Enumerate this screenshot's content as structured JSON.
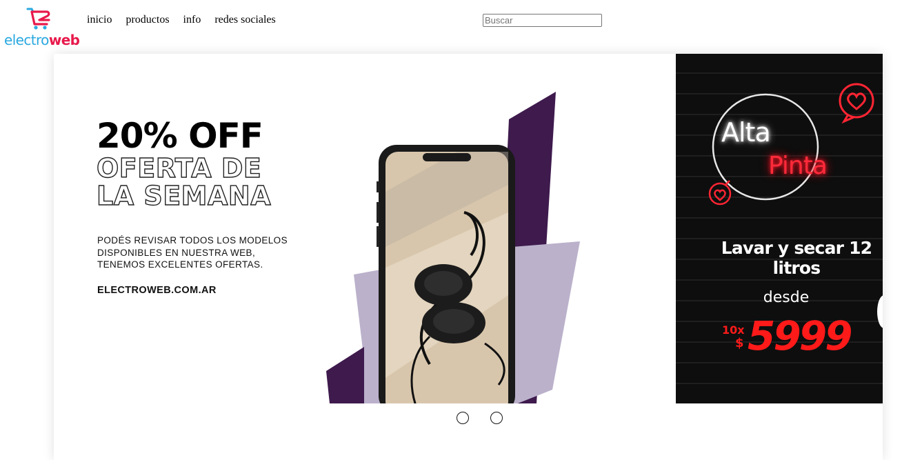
{
  "header": {
    "brand_part1": "electro",
    "brand_part2": "web",
    "logo_icon": "shopping-cart-icon",
    "nav": [
      "inicio",
      "productos",
      "info",
      "redes sociales"
    ],
    "search_placeholder": "Buscar"
  },
  "colors": {
    "brand_blue": "#29a8e0",
    "brand_red": "#e8194b",
    "promo_purple": "#3e1a4d",
    "promo_lilac": "#bbb1cb",
    "neon_red": "#ff1a1a"
  },
  "carousel": {
    "slide_main": {
      "discount": "20% OFF",
      "headline_line1": "OFERTA DE",
      "headline_line2": "LA SEMANA",
      "description": "PODÉS REVISAR TODOS LOS MODELOS DISPONIBLES EN NUESTRA WEB, TENEMOS EXCELENTES OFERTAS.",
      "url": "ELECTROWEB.COM.AR",
      "image": "phone-with-headphones"
    },
    "slide_side": {
      "neon_line1": "Alta",
      "neon_line2": "Pinta",
      "headline": "Lavar y secar 12 litros",
      "from_label": "desde",
      "installments": "10x",
      "currency": "$",
      "price": "5999",
      "icons": [
        "heart-chat-icon",
        "heart-chat-icon"
      ]
    },
    "indicators": {
      "count": 2
    }
  }
}
